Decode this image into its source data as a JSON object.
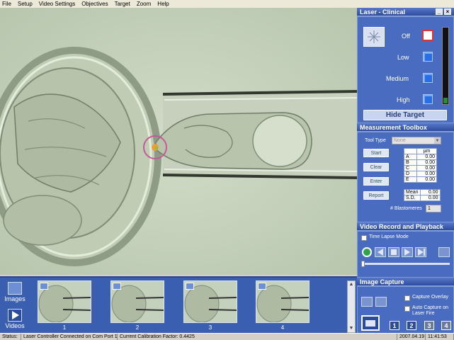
{
  "menu": [
    "File",
    "Setup",
    "Video Settings",
    "Objectives",
    "Target",
    "Zoom",
    "Help"
  ],
  "laser_panel": {
    "title": "Laser - Clinical",
    "off": "Off",
    "low": "Low",
    "medium": "Medium",
    "high": "High",
    "hide_target": "Hide Target"
  },
  "measurement": {
    "title": "Measurement Toolbox",
    "tool_type_label": "Tool Type",
    "tool_type_value": "None",
    "unit": "µm",
    "buttons": [
      "Start",
      "Clear",
      "Enter",
      "Report"
    ],
    "rows": [
      {
        "k": "A",
        "v": "0.00"
      },
      {
        "k": "B",
        "v": "0.00"
      },
      {
        "k": "C",
        "v": "0.00"
      },
      {
        "k": "D",
        "v": "0.00"
      },
      {
        "k": "E",
        "v": "0.00"
      }
    ],
    "stats": [
      {
        "k": "Mean",
        "v": "0.00"
      },
      {
        "k": "S.D.",
        "v": "0.00"
      }
    ],
    "blastomeres_label": "# Blastomeres",
    "blastomeres_value": "1"
  },
  "video": {
    "title": "Video Record and Playback",
    "time_lapse": "Time Lapse Mode"
  },
  "capture": {
    "title": "Image Capture",
    "overlay": "Capture Overlay",
    "auto": "Auto Capture on Laser Fire",
    "pages": [
      "1",
      "2",
      "3",
      "4"
    ]
  },
  "sidebar": {
    "images": "Images",
    "videos": "Videos"
  },
  "thumbnails": [
    "1",
    "2",
    "3",
    "4"
  ],
  "status": {
    "label": "Status:",
    "message": "Laser Controller Connected on Com Port 1",
    "calibration": "Current Calibration Factor: 0.4425",
    "date": "2007.04.19",
    "time": "11:41:53"
  }
}
